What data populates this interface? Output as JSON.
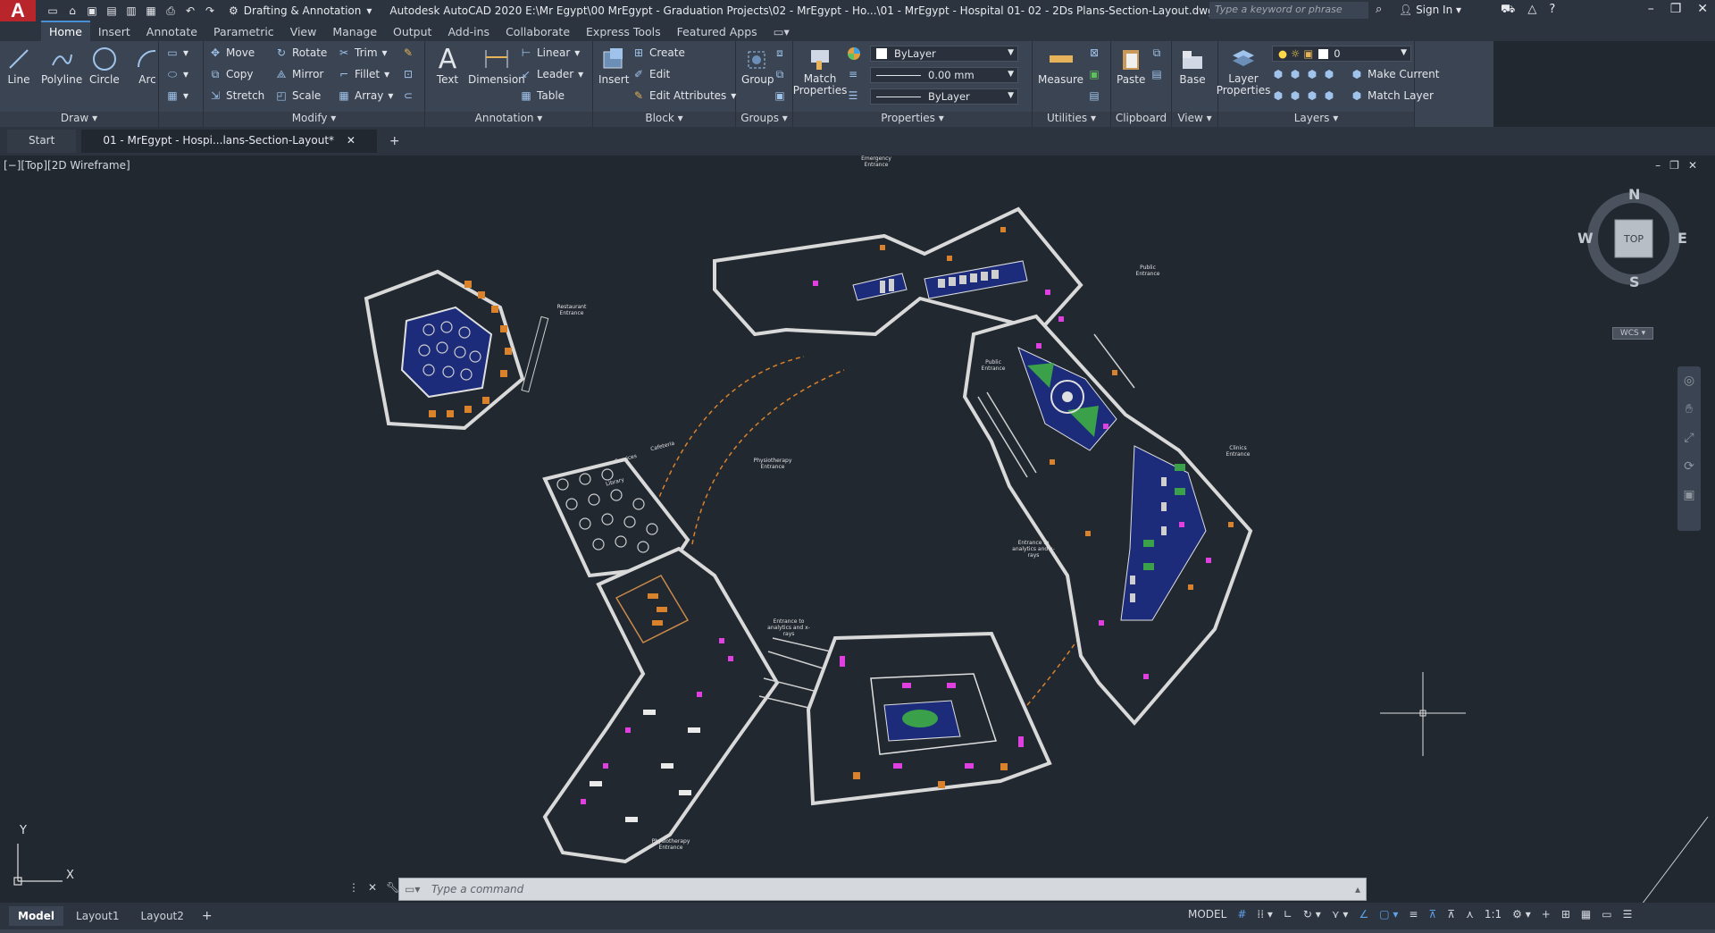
{
  "app": {
    "workspace": "Drafting & Annotation",
    "title": "Autodesk AutoCAD 2020   E:\\Mr Egypt\\00 MrEgypt - Graduation Projects\\02 - MrEgypt - Ho...\\01 - MrEgypt - Hospital 01- 02 - 2Ds Plans-Section-Layout.dwg",
    "search_placeholder": "Type a keyword or phrase",
    "signin": "Sign In",
    "logo_letter": "A"
  },
  "ribbon_tabs": [
    "Home",
    "Insert",
    "Annotate",
    "Parametric",
    "View",
    "Manage",
    "Output",
    "Add-ins",
    "Collaborate",
    "Express Tools",
    "Featured Apps"
  ],
  "panels": {
    "draw": {
      "title": "Draw ▾",
      "line": "Line",
      "polyline": "Polyline",
      "circle": "Circle",
      "arc": "Arc"
    },
    "modify": {
      "title": "Modify ▾",
      "move": "Move",
      "rotate": "Rotate",
      "trim": "Trim",
      "copy": "Copy",
      "mirror": "Mirror",
      "fillet": "Fillet",
      "stretch": "Stretch",
      "scale": "Scale",
      "array": "Array"
    },
    "annotation": {
      "title": "Annotation ▾",
      "text": "Text",
      "dimension": "Dimension",
      "linear": "Linear",
      "leader": "Leader",
      "table": "Table"
    },
    "block": {
      "title": "Block ▾",
      "insert": "Insert",
      "create": "Create",
      "edit": "Edit",
      "edit_attributes": "Edit Attributes"
    },
    "groups": {
      "title": "Groups ▾",
      "group": "Group"
    },
    "properties": {
      "title": "Properties ▾",
      "match": "Match Properties",
      "color": "ByLayer",
      "lineweight": "0.00 mm",
      "linetype": "ByLayer"
    },
    "utilities": {
      "title": "Utilities ▾",
      "measure": "Measure"
    },
    "clipboard": {
      "title": "Clipboard",
      "paste": "Paste"
    },
    "view": {
      "title": "View ▾",
      "base": "Base"
    },
    "layers": {
      "title": "Layers ▾",
      "layer_properties": "Layer Properties",
      "layer_current": "0",
      "make_current": "Make Current",
      "match_layer": "Match Layer"
    }
  },
  "file_tabs": {
    "start": "Start",
    "active": "01 - MrEgypt - Hospi...lans-Section-Layout*"
  },
  "viewport": {
    "label": "[−][Top][2D Wireframe]",
    "viewcube": {
      "n": "N",
      "s": "S",
      "e": "E",
      "w": "W",
      "face": "TOP",
      "wcs": "WCS ▾"
    },
    "ucs_y": "Y",
    "ucs_x": "X",
    "annotations": {
      "emergency": "Emergency Entrance",
      "restaurant": "Restaurant Entrance",
      "public1": "Public Entrance",
      "public2": "Public Entrance",
      "physio1": "Physiotherapy Entrance",
      "physio2": "Physiotherapy Entrance",
      "clinics": "Clinics Entrance",
      "xray1": "Entrance to analytics and x-rays",
      "xray2": "Entrance to analytics and x-rays",
      "cafeteria": "Cafeteria",
      "services": "Services",
      "library": "Library"
    }
  },
  "command_placeholder": "Type a command",
  "layout_tabs": [
    "Model",
    "Layout1",
    "Layout2"
  ],
  "status": {
    "model": "MODEL",
    "scale": "1:1"
  },
  "colors": {
    "accent": "#4a8fd6",
    "background": "#212830",
    "walls": "#d9d9d9",
    "magenta": "#e040e0",
    "orange": "#d9822b",
    "green": "#3aa04a",
    "navy": "#1c2b7a"
  }
}
